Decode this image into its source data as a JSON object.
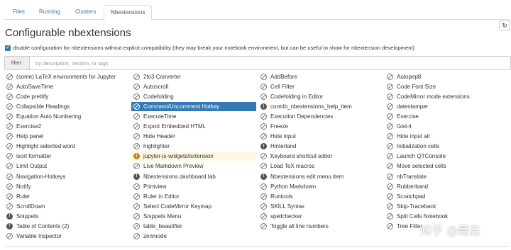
{
  "tabs": [
    {
      "label": "Files"
    },
    {
      "label": "Running"
    },
    {
      "label": "Clusters"
    },
    {
      "label": "Nbextensions"
    }
  ],
  "page_title": "Configurable nbextensions",
  "disable_checkbox": {
    "checked": true,
    "label": "disable configuration for nbextensions without explicit compatibility (they may break your notebook environment, but can be useful to show for nbextension development)"
  },
  "filter": {
    "label": "filter:",
    "placeholder": "by description, section, or tags"
  },
  "refresh_icon": "refresh-icon",
  "columns": [
    [
      {
        "label": "(some) LaTeX environments for Jupyter",
        "status": "disabled"
      },
      {
        "label": "AutoSaveTime",
        "status": "disabled"
      },
      {
        "label": "Code prettify",
        "status": "disabled"
      },
      {
        "label": "Collapsible Headings",
        "status": "disabled"
      },
      {
        "label": "Equation Auto Numbering",
        "status": "disabled"
      },
      {
        "label": "Exercise2",
        "status": "disabled"
      },
      {
        "label": "Help panel",
        "status": "disabled"
      },
      {
        "label": "Highlight selected word",
        "status": "disabled"
      },
      {
        "label": "isort formatter",
        "status": "disabled"
      },
      {
        "label": "Limit Output",
        "status": "disabled"
      },
      {
        "label": "Navigation-Hotkeys",
        "status": "disabled"
      },
      {
        "label": "Notify",
        "status": "disabled"
      },
      {
        "label": "Ruler",
        "status": "disabled"
      },
      {
        "label": "ScrollDown",
        "status": "disabled"
      },
      {
        "label": "Snippets",
        "status": "incompatible"
      },
      {
        "label": "Table of Contents (2)",
        "status": "incompatible"
      },
      {
        "label": "Variable Inspector",
        "status": "disabled"
      }
    ],
    [
      {
        "label": "2to3 Converter",
        "status": "disabled"
      },
      {
        "label": "Autoscroll",
        "status": "disabled"
      },
      {
        "label": "Codefolding",
        "status": "disabled"
      },
      {
        "label": "Comment/Uncomment Hotkey",
        "status": "disabled",
        "selected": true
      },
      {
        "label": "ExecuteTime",
        "status": "disabled"
      },
      {
        "label": "Export Embedded HTML",
        "status": "disabled"
      },
      {
        "label": "Hide Header",
        "status": "disabled"
      },
      {
        "label": "highlighter",
        "status": "disabled"
      },
      {
        "label": "jupyter-js-widgets/extension",
        "status": "warning",
        "highlight": true
      },
      {
        "label": "Live Markdown Preview",
        "status": "disabled"
      },
      {
        "label": "Nbextensions dashboard tab",
        "status": "incompatible"
      },
      {
        "label": "Printview",
        "status": "disabled"
      },
      {
        "label": "Ruler in Editor",
        "status": "disabled"
      },
      {
        "label": "Select CodeMirror Keymap",
        "status": "disabled"
      },
      {
        "label": "Snippets Menu",
        "status": "disabled"
      },
      {
        "label": "table_beautifier",
        "status": "disabled"
      },
      {
        "label": "zenmode",
        "status": "disabled"
      }
    ],
    [
      {
        "label": "AddBefore",
        "status": "disabled"
      },
      {
        "label": "Cell Filter",
        "status": "disabled"
      },
      {
        "label": "Codefolding in Editor",
        "status": "disabled"
      },
      {
        "label": "contrib_nbextensions_help_item",
        "status": "incompatible"
      },
      {
        "label": "Execution Dependencies",
        "status": "disabled"
      },
      {
        "label": "Freeze",
        "status": "disabled"
      },
      {
        "label": "Hide input",
        "status": "disabled"
      },
      {
        "label": "Hinterland",
        "status": "incompatible"
      },
      {
        "label": "Keyboard shortcut editor",
        "status": "disabled"
      },
      {
        "label": "Load TeX macros",
        "status": "disabled"
      },
      {
        "label": "Nbextensions edit menu item",
        "status": "incompatible"
      },
      {
        "label": "Python Markdown",
        "status": "disabled"
      },
      {
        "label": "Runtools",
        "status": "disabled"
      },
      {
        "label": "SKILL Syntax",
        "status": "disabled"
      },
      {
        "label": "spellchecker",
        "status": "disabled"
      },
      {
        "label": "Toggle all line numbers",
        "status": "disabled"
      }
    ],
    [
      {
        "label": "Autopep8",
        "status": "disabled"
      },
      {
        "label": "Code Font Size",
        "status": "disabled"
      },
      {
        "label": "CodeMirror mode extensions",
        "status": "disabled"
      },
      {
        "label": "datestamper",
        "status": "disabled"
      },
      {
        "label": "Exercise",
        "status": "disabled"
      },
      {
        "label": "Gist-it",
        "status": "disabled"
      },
      {
        "label": "Hide input all",
        "status": "disabled"
      },
      {
        "label": "Initialization cells",
        "status": "disabled"
      },
      {
        "label": "Launch QTConsole",
        "status": "disabled"
      },
      {
        "label": "Move selected cells",
        "status": "disabled"
      },
      {
        "label": "nbTranslate",
        "status": "disabled"
      },
      {
        "label": "Rubberband",
        "status": "disabled"
      },
      {
        "label": "Scratchpad",
        "status": "disabled"
      },
      {
        "label": "Skip-Traceback",
        "status": "disabled"
      },
      {
        "label": "Split Cells Notebook",
        "status": "disabled"
      },
      {
        "label": "Tree Filter",
        "status": "disabled"
      }
    ]
  ],
  "status_icons": {
    "disabled": "disabled-circle-icon",
    "incompatible": "info-circle-icon",
    "warning": "warning-circle-icon"
  },
  "colors": {
    "selected": "#337ab7",
    "highlight": "#fcf8e3",
    "link": "#337ab7",
    "warning": "#c08a1f"
  },
  "watermark": "知乎 @聂志"
}
